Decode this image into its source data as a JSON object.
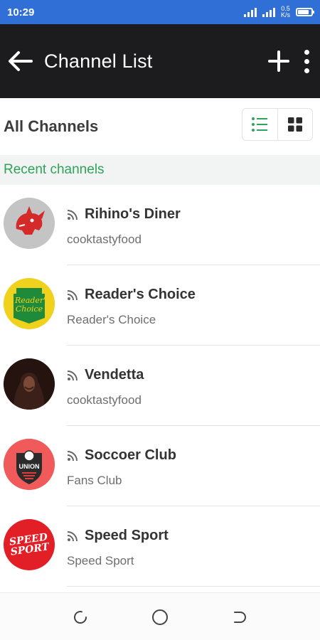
{
  "status_bar": {
    "time": "10:29",
    "network_label": "0.5\nK/s",
    "battery_level": 0.85
  },
  "app_bar": {
    "title": "Channel List",
    "back_icon": "arrow-left-icon",
    "add_icon": "plus-icon",
    "menu_icon": "more-vertical-icon"
  },
  "section": {
    "title": "All Channels",
    "list_view_icon": "list-view-icon",
    "grid_view_icon": "grid-view-icon"
  },
  "recent": {
    "label": "Recent channels"
  },
  "channels": [
    {
      "name": "Rihino's Diner",
      "owner": "cooktastyfood",
      "avatar": "rhino-logo"
    },
    {
      "name": "Reader's Choice",
      "owner": "Reader's Choice",
      "avatar": "readers-choice-logo",
      "logo_text": "Reader's Choice"
    },
    {
      "name": "Vendetta",
      "owner": "cooktastyfood",
      "avatar": "hooded-figure"
    },
    {
      "name": "Soccoer Club",
      "owner": "Fans Club",
      "avatar": "union-logo",
      "logo_text": "UNION"
    },
    {
      "name": "Speed Sport",
      "owner": "Speed Sport",
      "avatar": "speed-sport-logo",
      "logo_text": "SPEED SPORT"
    }
  ],
  "colors": {
    "status_bar": "#2f6fd6",
    "app_bar": "#1c1c1e",
    "accent_green": "#2ea35a",
    "recent_bg": "#f2f3f3"
  }
}
